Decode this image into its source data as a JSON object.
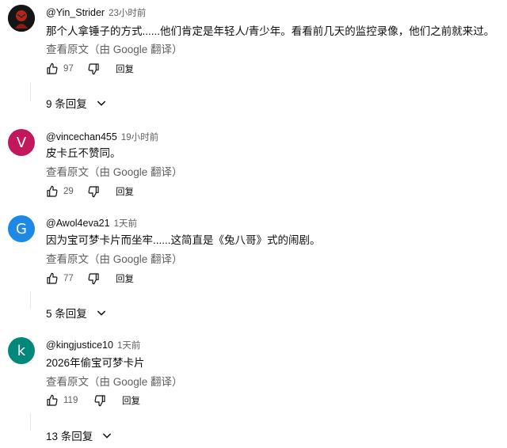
{
  "comments": [
    {
      "handle": "@Yin_Strider",
      "time": "23小时前",
      "text": "那个人拿锤子的方式......他们肯定是年轻人/青少年。看看前几天的监控录像，他们之前就来过。",
      "translate": "查看原文（由 Google 翻译）",
      "likes": "97",
      "reply": "回复",
      "replies": "9 条回复",
      "avatar_letter": "",
      "avatar_color": "#1a1a1a"
    },
    {
      "handle": "@vincechan455",
      "time": "19小时前",
      "text": "皮卡丘不赞同。",
      "translate": "查看原文（由 Google 翻译）",
      "likes": "29",
      "reply": "回复",
      "avatar_letter": "V",
      "avatar_color": "#c2185b"
    },
    {
      "handle": "@Awol4eva21",
      "time": "1天前",
      "text": "因为宝可梦卡片而坐牢......这简直是《兔八哥》式的闹剧。",
      "translate": "查看原文（由 Google 翻译）",
      "likes": "77",
      "reply": "回复",
      "replies": "5 条回复",
      "avatar_letter": "G",
      "avatar_color": "#1e88e5"
    },
    {
      "handle": "@kingjustice10",
      "time": "1天前",
      "text": "2026年偷宝可梦卡片",
      "translate": "查看原文（由 Google 翻译）",
      "likes": "119",
      "reply": "回复",
      "replies": "13 条回复",
      "avatar_letter": "k",
      "avatar_color": "#00897b"
    }
  ],
  "icons": {
    "like": "thumb-up-icon",
    "dislike": "thumb-down-icon",
    "expand": "chevron-down-icon"
  }
}
